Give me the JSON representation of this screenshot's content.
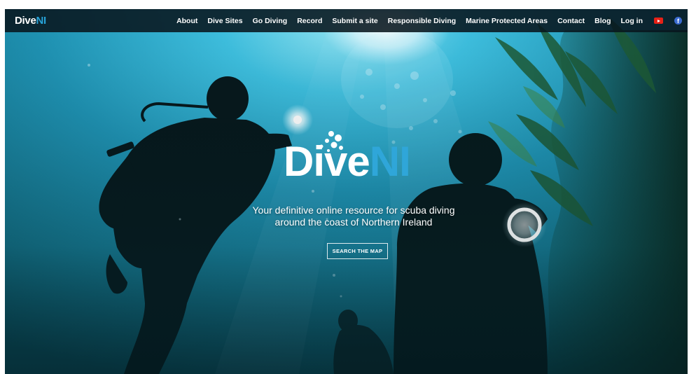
{
  "brand": {
    "logo_part1": "Dive",
    "logo_part2": "NI"
  },
  "nav": {
    "items": [
      {
        "label": "About"
      },
      {
        "label": "Dive Sites"
      },
      {
        "label": "Go Diving"
      },
      {
        "label": "Record"
      },
      {
        "label": "Submit a site"
      },
      {
        "label": "Responsible Diving"
      },
      {
        "label": "Marine Protected Areas"
      },
      {
        "label": "Contact"
      },
      {
        "label": "Blog"
      },
      {
        "label": "Log in"
      }
    ],
    "social": {
      "youtube_icon": "youtube-icon",
      "facebook_icon": "facebook-icon",
      "facebook_glyph": "f"
    }
  },
  "hero": {
    "logo_part1": "Dive",
    "logo_part2": "NI",
    "tagline": "Your definitive online resource for scuba diving around the coast of Northern Ireland",
    "cta_label": "SEARCH THE MAP"
  },
  "colors": {
    "brand_blue": "#2fa6d9",
    "nav_bg": "#08161e",
    "water_light": "#39b6d8",
    "water_deep": "#0b4c5c",
    "youtube_red": "#e62117",
    "facebook_blue": "#3b6bd0"
  }
}
